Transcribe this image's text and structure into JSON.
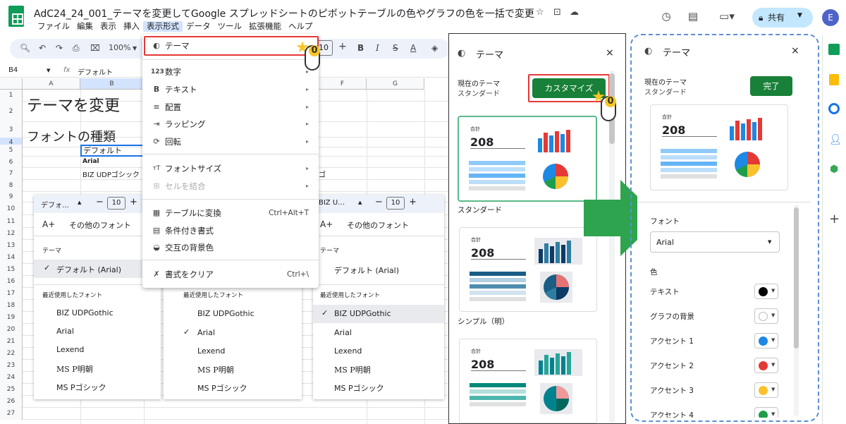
{
  "header": {
    "doc_title": "AdC24_24_001_テーマを変更してGoogle スプレッドシートのピボットテーブルの色やグラフの色を一括で変更",
    "menu": [
      "ファイル",
      "編集",
      "表示",
      "挿入",
      "表示形式",
      "データ",
      "ツール",
      "拡張機能",
      "ヘルプ"
    ],
    "share_label": "共有",
    "avatar_letter": "E"
  },
  "toolbar": {
    "zoom": "100%",
    "font_size": "10"
  },
  "formula_bar": {
    "cell_ref": "B4",
    "fx": "fx",
    "content": "デフォルト"
  },
  "sheet": {
    "columns": [
      "A",
      "B",
      "F",
      "G"
    ],
    "row_numbers": [
      "1",
      "2",
      "3",
      "4",
      "5",
      "6",
      "7",
      "8",
      "9",
      "10",
      "11",
      "12",
      "13",
      "14",
      "15",
      "16",
      "17",
      "18",
      "19",
      "20",
      "21",
      "22",
      "23",
      "24",
      "25",
      "26",
      "27"
    ],
    "heading1": "テーマを変更",
    "heading2": "フォントの種類",
    "b4": "デフォルト",
    "b5": "Arial",
    "b6": "BIZ UDPゴシック",
    "f6_partial": "ゴ"
  },
  "format_menu": {
    "items": [
      {
        "icon": "palette-icon",
        "label": "テーマ",
        "arrow": ""
      },
      {
        "icon": "123",
        "label": "数字",
        "arrow": "▸"
      },
      {
        "icon": "B",
        "label": "テキスト",
        "arrow": "▸"
      },
      {
        "icon": "≡",
        "label": "配置",
        "arrow": "▸"
      },
      {
        "icon": "⇥",
        "label": "ラッピング",
        "arrow": "▸"
      },
      {
        "icon": "⟳",
        "label": "回転",
        "arrow": "▸"
      },
      {
        "icon": "тT",
        "label": "フォントサイズ",
        "arrow": "▸"
      },
      {
        "icon": "⊞",
        "label": "セルを結合",
        "arrow": "▸"
      },
      {
        "icon": "▦",
        "label": "テーブルに変換",
        "shortcut": "Ctrl+Alt+T"
      },
      {
        "icon": "▤",
        "label": "条件付き書式",
        "shortcut": ""
      },
      {
        "icon": "◒",
        "label": "交互の背景色",
        "shortcut": ""
      },
      {
        "icon": "✗",
        "label": "書式をクリア",
        "shortcut": "Ctrl+\\"
      }
    ]
  },
  "font_panels": [
    {
      "font_label": "デフォ…",
      "size": "10",
      "more_fonts": "その他のフォント",
      "theme_header": "テーマ",
      "theme_item": "デフォルト (Arial)",
      "recent_header": "最近使用したフォント",
      "recent": [
        "BIZ UDPGothic",
        "Arial",
        "Lexend",
        "MS P明朝",
        "MS Pゴシック"
      ],
      "checked": "theme"
    },
    {
      "font_label": "",
      "size": "",
      "more_fonts": "",
      "theme_header": "",
      "theme_item": "",
      "recent_header": "最近使用したフォント",
      "recent": [
        "BIZ UDPGothic",
        "Arial",
        "Lexend",
        "MS P明朝",
        "MS Pゴシック"
      ],
      "checked": "Arial"
    },
    {
      "font_label": "BIZ U…",
      "size": "10",
      "more_fonts": "その他のフォント",
      "theme_header": "テーマ",
      "theme_item": "デフォルト (Arial)",
      "recent_header": "最近使用したフォント",
      "recent": [
        "BIZ UDPGothic",
        "Arial",
        "Lexend",
        "MS P明朝",
        "MS Pゴシック"
      ],
      "checked": "BIZ UDPGothic"
    }
  ],
  "theme_panel_left": {
    "title": "テーマ",
    "current_label": "現在のテーマ",
    "current_value": "スタンダード",
    "customize_button": "カスタマイズ",
    "themes": [
      {
        "name": "スタンダード",
        "total_label": "合計",
        "total": "208"
      },
      {
        "name": "シンプル（明）",
        "total_label": "合計",
        "total": "208"
      },
      {
        "name": "",
        "total_label": "合計",
        "total": "208"
      }
    ]
  },
  "theme_panel_right": {
    "title": "テーマ",
    "current_label": "現在のテーマ",
    "current_value": "スタンダード",
    "done_button": "完了",
    "preview_total_label": "合計",
    "preview_total": "208",
    "font_section": "フォント",
    "font_value": "Arial",
    "color_section": "色",
    "colors": [
      {
        "label": "テキスト",
        "color": "#000000"
      },
      {
        "label": "グラフの背景",
        "color": "#ffffff"
      },
      {
        "label": "アクセント 1",
        "color": "#1e88e5"
      },
      {
        "label": "アクセント 2",
        "color": "#e53935"
      },
      {
        "label": "アクセント 3",
        "color": "#fbc02d"
      },
      {
        "label": "アクセント 4",
        "color": "#1e9e4a"
      }
    ]
  },
  "cursor_label": "0"
}
